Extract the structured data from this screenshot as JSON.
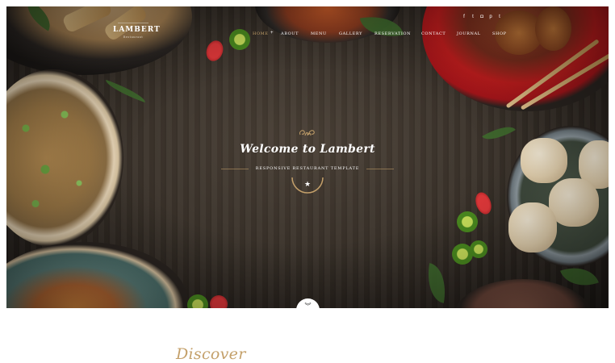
{
  "brand": {
    "logo_text": "LAMBERT",
    "logo_subtitle": "Restaurant"
  },
  "nav": {
    "items": [
      {
        "label": "HOME",
        "active": true
      },
      {
        "label": "ABOUT"
      },
      {
        "label": "MENU"
      },
      {
        "label": "GALLERY"
      },
      {
        "label": "RESERVATION"
      },
      {
        "label": "CONTACT"
      },
      {
        "label": "JOURNAL"
      },
      {
        "label": "SHOP"
      }
    ],
    "home_plus": "+"
  },
  "social": [
    {
      "name": "facebook-icon",
      "glyph": "f"
    },
    {
      "name": "twitter-icon",
      "glyph": "t"
    },
    {
      "name": "instagram-icon",
      "glyph": "◘"
    },
    {
      "name": "pinterest-icon",
      "glyph": "p"
    },
    {
      "name": "tumblr-icon",
      "glyph": "t"
    }
  ],
  "hero": {
    "title": "Welcome to Lambert",
    "subtitle": "RESPONSIVE RESTAURANT TEMPLATE",
    "star": "★",
    "scroll_glyph": "︾"
  },
  "section": {
    "heading": "Discover"
  },
  "colors": {
    "accent": "#c4a06a",
    "hero_bg": "#3a322a",
    "white": "#ffffff"
  }
}
